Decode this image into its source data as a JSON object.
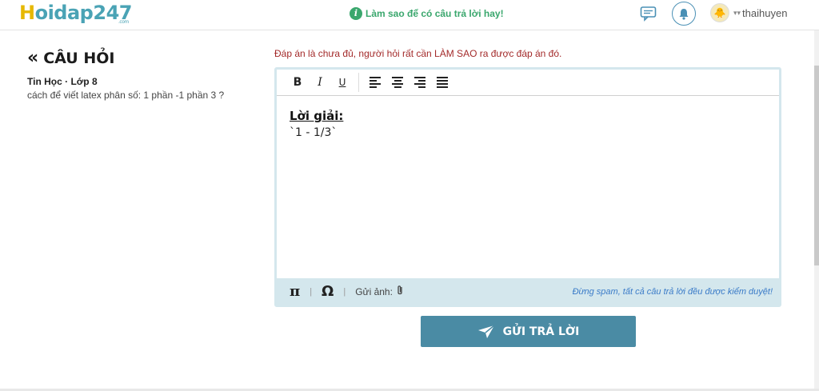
{
  "header": {
    "logo_h": "H",
    "logo_rest": "oidap247",
    "logo_sub": ".com",
    "tip_icon": "i",
    "tip_text": "Làm sao để có câu trả lời hay!",
    "username": "thaihuyen",
    "icons": [
      "chat-icon",
      "bell-icon",
      "avatar"
    ]
  },
  "question": {
    "title": "CÂU HỎI",
    "back_arrow": "«",
    "meta": "Tin Học · Lớp 8",
    "body": "cách để viết latex phân số: 1 phần -1 phần 3 ?"
  },
  "answer": {
    "warning": "Đáp án là chưa đủ, người hỏi rất cần LÀM SAO ra được đáp án đó.",
    "toolbar": {
      "bold": "B",
      "italic": "I",
      "underline": "U"
    },
    "solution_label": "Lời giải:",
    "solution_text": "`1 - 1/3`",
    "footer": {
      "pi": "π",
      "omega": "Ω",
      "send_image": "Gửi ảnh:",
      "note": "Đừng spam, tất cả câu trả lời đều được kiểm duyệt!"
    },
    "submit_label": "GỬI TRẢ LỜI"
  },
  "colors": {
    "brand": "#4aa3b5",
    "accent_green": "#3aa76d",
    "warning": "#a32a2a",
    "button": "#4a8ba4"
  }
}
